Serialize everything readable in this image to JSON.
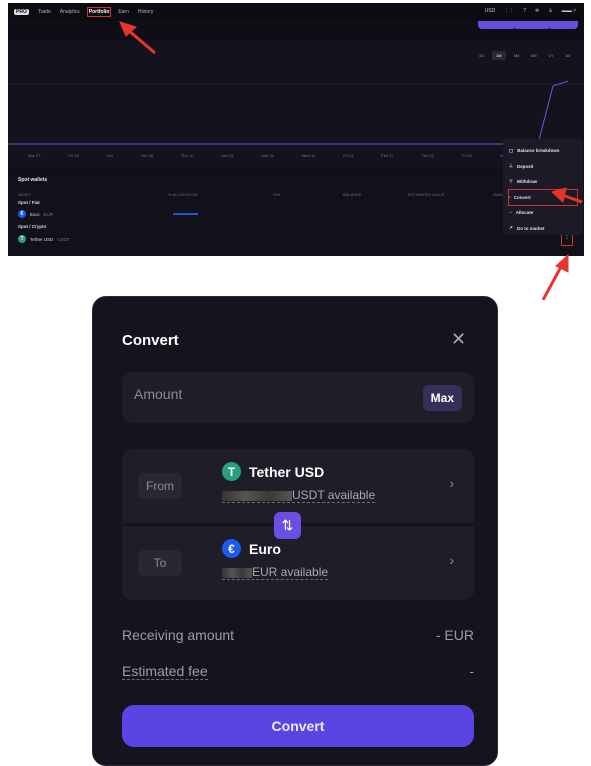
{
  "portfolio": {
    "nav": {
      "logo": "PRO",
      "items": [
        "Trade",
        "Analytics",
        "Portfolio",
        "Earn",
        "History"
      ],
      "active": "Portfolio",
      "currency": "USD"
    },
    "ranges": [
      "1D",
      "1M",
      "3M",
      "6M",
      "1Y",
      "All"
    ],
    "active_range": "1M",
    "dates": [
      "Mar 27",
      "Fri 29",
      "Oct",
      "Tue 08",
      "Thu 10",
      "Jan 15",
      "Mar 29",
      "Wed 11",
      "Fri 13",
      "Feb 27",
      "Thu 02",
      "Fri 21",
      "Mon"
    ],
    "spot": {
      "title": "Spot wallets",
      "columns": [
        "ASSET",
        "% ALLOCATION",
        "24H",
        "BALANCE",
        "ESTIMATED VALUE",
        "AVAILABLE"
      ],
      "groups": [
        {
          "label": "Spot / Fiat",
          "asset": "Euro",
          "code": "EUR"
        },
        {
          "label": "Spot / Crypto",
          "asset": "Tether USD",
          "code": "USDT"
        }
      ]
    },
    "menu": [
      "Balance breakdown",
      "Deposit",
      "Withdraw",
      "Convert",
      "Allocate",
      "Go to market"
    ],
    "menu_icons": [
      "wallet-icon",
      "download-icon",
      "upload-icon",
      "pencil-icon",
      "pie-icon",
      "arrow-icon"
    ]
  },
  "modal": {
    "title": "Convert",
    "amount_placeholder": "Amount",
    "max": "Max",
    "from": {
      "label": "From",
      "asset": "Tether USD",
      "available": "USDT available"
    },
    "to": {
      "label": "To",
      "asset": "Euro",
      "available": "EUR available"
    },
    "receiving_label": "Receiving amount",
    "receiving_value": "- EUR",
    "fee_label": "Estimated fee",
    "fee_value": "-",
    "convert": "Convert"
  },
  "colors": {
    "accent": "#5a45e3",
    "tether": "#26a17b",
    "euro": "#1a5cf0",
    "annotation": "#e8352a"
  }
}
